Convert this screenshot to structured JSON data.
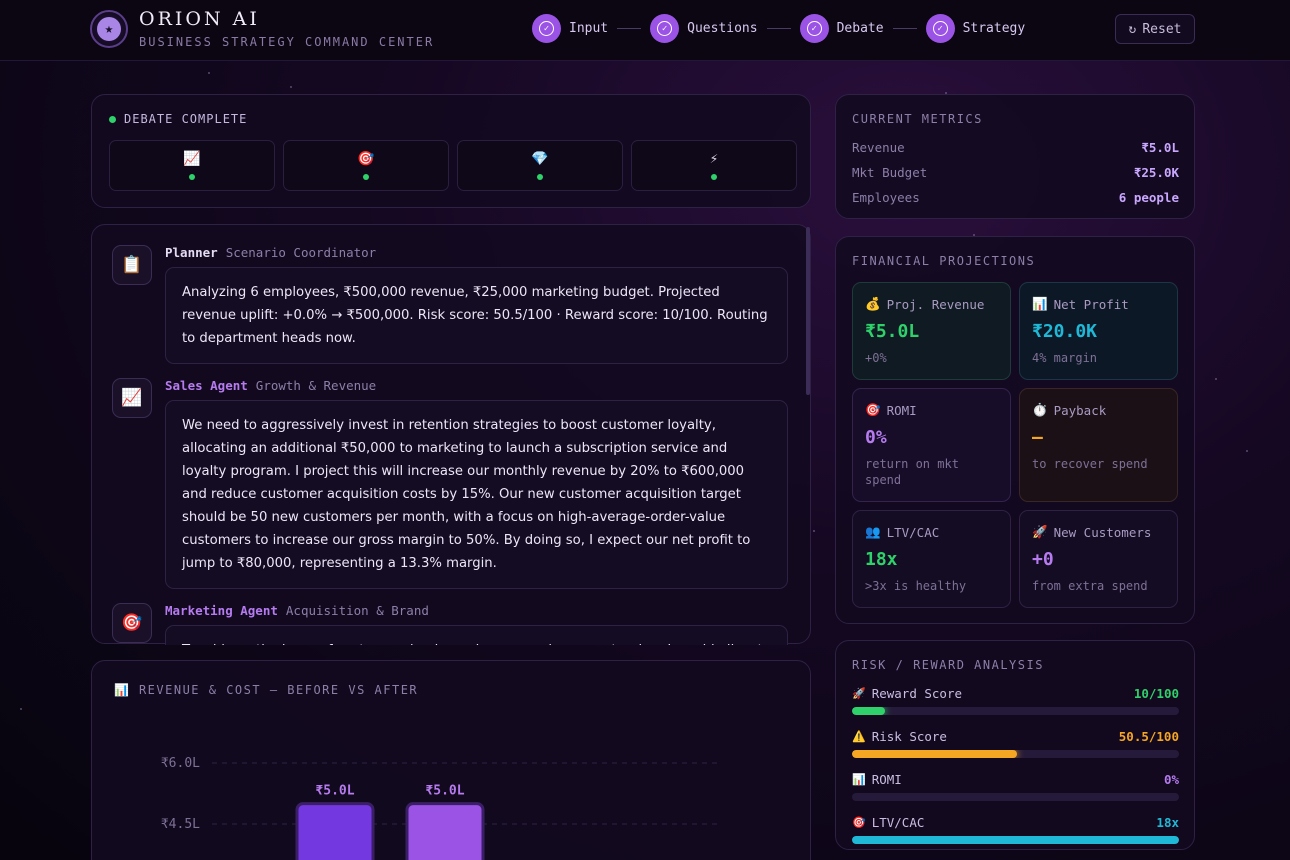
{
  "header": {
    "title": "ORION AI",
    "subtitle": "BUSINESS STRATEGY COMMAND CENTER",
    "logo_icon": "star-icon",
    "steps": [
      {
        "label": "Input",
        "done": true
      },
      {
        "label": "Questions",
        "done": true
      },
      {
        "label": "Debate",
        "done": true
      },
      {
        "label": "Strategy",
        "done": true
      }
    ],
    "reset_label": "Reset"
  },
  "debate_status": {
    "label": "DEBATE COMPLETE",
    "status_color": "#2fd16a",
    "agents": [
      {
        "icon": "📈",
        "name": "chart-icon"
      },
      {
        "icon": "🎯",
        "name": "target-icon"
      },
      {
        "icon": "💎",
        "name": "gem-icon"
      },
      {
        "icon": "⚡",
        "name": "lightning-icon"
      }
    ]
  },
  "chat": {
    "messages": [
      {
        "icon": "📋",
        "name": "Planner",
        "name_color": "#e4dcf2",
        "role": "Scenario Coordinator",
        "text": "Analyzing 6 employees, ₹500,000 revenue, ₹25,000 marketing budget. Projected revenue uplift: +0.0% → ₹500,000. Risk score: 50.5/100 · Reward score: 10/100. Routing to department heads now."
      },
      {
        "icon": "📈",
        "name": "Sales Agent",
        "name_color": "#b57bef",
        "role": "Growth & Revenue",
        "text": "We need to aggressively invest in retention strategies to boost customer loyalty, allocating an additional ₹50,000 to marketing to launch a subscription service and loyalty program. I project this will increase our monthly revenue by 20% to ₹600,000 and reduce customer acquisition costs by 15%. Our new customer acquisition target should be 50 new customers per month, with a focus on high-average-order-value customers to increase our gross margin to 50%. By doing so, I expect our net profit to jump to ₹80,000, representing a 13.3% margin."
      },
      {
        "icon": "🎯",
        "name": "Marketing Agent",
        "name_color": "#b57bef",
        "role": "Acquisition & Brand",
        "text": "To address the issue of customers buying only once and never returning, I would allocate the ₹25,000 marketing budget to retention-focused campaigns and a loyalty program..."
      }
    ]
  },
  "revenue_chart": {
    "title_icon": "📊",
    "title": "REVENUE & COST — BEFORE VS AFTER"
  },
  "chart_data": {
    "type": "bar",
    "title": "REVENUE & COST — BEFORE VS AFTER",
    "y_ticks": [
      "₹6.0L",
      "₹4.5L"
    ],
    "ylim_lakh": [
      0,
      6.0
    ],
    "bars": [
      {
        "label": "₹5.0L",
        "value_lakh": 5.0,
        "color": "#7338e0"
      },
      {
        "label": "₹5.0L",
        "value_lakh": 5.0,
        "color": "#9b53e6"
      }
    ]
  },
  "current_metrics": {
    "title": "CURRENT METRICS",
    "rows": [
      {
        "key": "Revenue",
        "value": "₹5.0L"
      },
      {
        "key": "Mkt Budget",
        "value": "₹25.0K"
      },
      {
        "key": "Employees",
        "value": "6 people"
      }
    ]
  },
  "financial_projections": {
    "title": "FINANCIAL PROJECTIONS",
    "cards": [
      {
        "icon": "💰",
        "label": "Proj. Revenue",
        "value": "₹5.0L",
        "sub": "+0%",
        "color": "#2fd16a",
        "bg": "#0f1a22",
        "border": "#1f3a3a"
      },
      {
        "icon": "📊",
        "label": "Net Profit",
        "value": "₹20.0K",
        "sub": "4% margin",
        "color": "#1fb8d6",
        "bg": "#0d1826",
        "border": "#1d3546"
      },
      {
        "icon": "🎯",
        "label": "ROMI",
        "value": "0%",
        "sub": "return on mkt spend",
        "color": "#b57bef",
        "bg": "#180d28",
        "border": "#33234d"
      },
      {
        "icon": "⏱️",
        "label": "Payback",
        "value": "—",
        "sub": "to recover spend",
        "color": "#f5a623",
        "bg": "#1a1016",
        "border": "#3a2626"
      },
      {
        "icon": "👥",
        "label": "LTV/CAC",
        "value": "18x",
        "sub": ">3x is healthy",
        "color": "#2fd16a",
        "bg": "#130c22",
        "border": "#2e2145"
      },
      {
        "icon": "🚀",
        "label": "New Customers",
        "value": "+0",
        "sub": "from extra spend",
        "color": "#b57bef",
        "bg": "#130c22",
        "border": "#2e2145"
      }
    ]
  },
  "risk_reward": {
    "title": "RISK / REWARD ANALYSIS",
    "items": [
      {
        "icon": "🚀",
        "label": "Reward Score",
        "value": "10/100",
        "fill": 0.1,
        "color": "#2fd16a"
      },
      {
        "icon": "⚠️",
        "label": "Risk Score",
        "value": "50.5/100",
        "fill": 0.505,
        "color": "#f5a623"
      },
      {
        "icon": "📊",
        "label": "ROMI",
        "value": "0%",
        "fill": 0.0,
        "color": "#b57bef"
      },
      {
        "icon": "🎯",
        "label": "LTV/CAC",
        "value": "18x",
        "fill": 1.0,
        "color": "#1fb8d6"
      }
    ]
  }
}
